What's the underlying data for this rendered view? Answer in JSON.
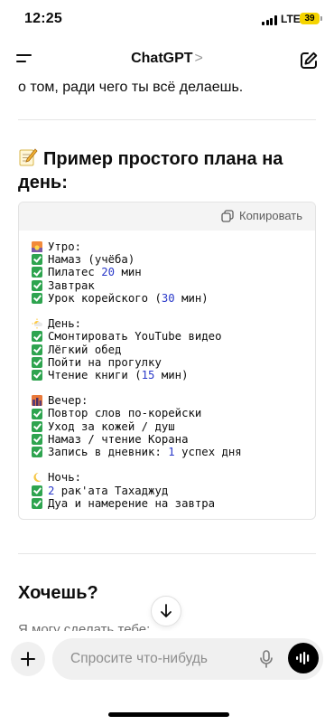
{
  "status": {
    "time": "12:25",
    "network": "LTE",
    "battery": "39"
  },
  "nav": {
    "title": "ChatGPT",
    "chevron": ">"
  },
  "message": {
    "prev_line": "о том, ради чего ты всё делаешь.",
    "heading_emoji": "memo-icon",
    "heading": "Пример простого плана на день:",
    "copy_label": "Копировать",
    "plan_lines": [
      {
        "icon": "sunrise",
        "text": "Утро:"
      },
      {
        "icon": "check",
        "text": "Намаз (учёба)"
      },
      {
        "icon": "check",
        "text": "Пилатес ",
        "num": "20",
        "after": " мин"
      },
      {
        "icon": "check",
        "text": "Завтрак"
      },
      {
        "icon": "check",
        "text": "Урок корейского (",
        "num": "30",
        "after": " мин)"
      },
      {
        "icon": "gap"
      },
      {
        "icon": "sun",
        "text": "День:"
      },
      {
        "icon": "check",
        "text": "Смонтировать YouTube видео"
      },
      {
        "icon": "check",
        "text": "Лёгкий обед"
      },
      {
        "icon": "check",
        "text": "Пойти на прогулку"
      },
      {
        "icon": "check",
        "text": "Чтение книги (",
        "num": "15",
        "after": " мин)"
      },
      {
        "icon": "gap"
      },
      {
        "icon": "cityscape",
        "text": "Вечер:"
      },
      {
        "icon": "check",
        "text": "Повтор слов по-корейски"
      },
      {
        "icon": "check",
        "text": "Уход за кожей / душ"
      },
      {
        "icon": "check",
        "text": "Намаз / чтение Корана"
      },
      {
        "icon": "check",
        "text": "Запись в дневник: ",
        "num": "1",
        "after": " успех дня"
      },
      {
        "icon": "gap"
      },
      {
        "icon": "moon",
        "text": "Ночь:"
      },
      {
        "icon": "check",
        "text": "",
        "num": "2",
        "after": " рак'ата Тахаджуд"
      },
      {
        "icon": "check",
        "text": "Дуа и намерение на завтра"
      }
    ],
    "next_heading": "Хочешь?",
    "next_text": "Я могу сделать тебе:"
  },
  "composer": {
    "placeholder": "Спросите что-нибудь"
  },
  "colors": {
    "check": "#2ea44f",
    "number": "#2a39c9"
  }
}
